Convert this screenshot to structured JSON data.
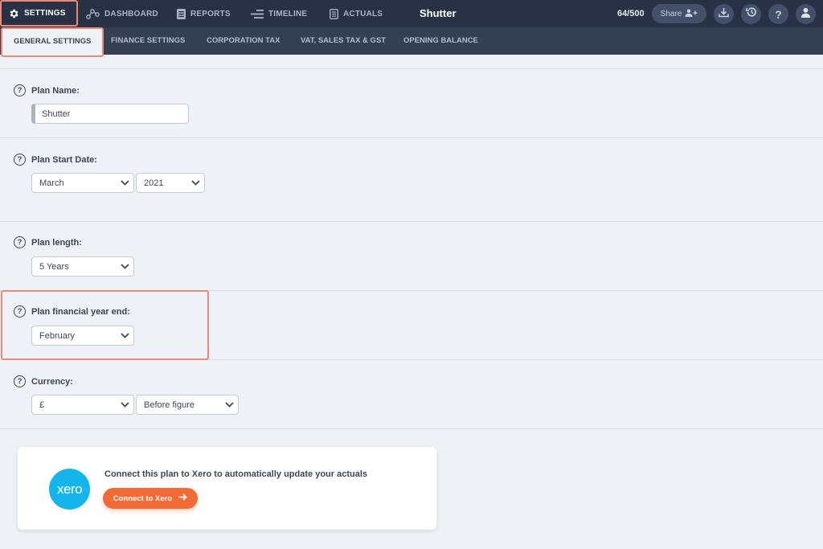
{
  "nav": {
    "items": [
      {
        "label": "SETTINGS",
        "icon": "gear-icon",
        "active": true
      },
      {
        "label": "DASHBOARD",
        "icon": "nodes-icon"
      },
      {
        "label": "REPORTS",
        "icon": "report-icon"
      },
      {
        "label": "TIMELINE",
        "icon": "timeline-icon"
      },
      {
        "label": "ACTUALS",
        "icon": "document-icon"
      }
    ],
    "plan_title": "Shutter",
    "usage": "64/500",
    "share_label": "Share",
    "buttons": [
      "download-icon",
      "history-icon",
      "help-icon",
      "account-icon"
    ],
    "help_glyph": "?"
  },
  "subtabs": [
    {
      "label": "GENERAL SETTINGS",
      "active": true
    },
    {
      "label": "FINANCE SETTINGS"
    },
    {
      "label": "CORPORATION TAX"
    },
    {
      "label": "VAT, SALES TAX & GST"
    },
    {
      "label": "OPENING BALANCE"
    }
  ],
  "help_glyph": "?",
  "fields": {
    "plan_name": {
      "label": "Plan Name:",
      "value": "Shutter"
    },
    "start_date": {
      "label": "Plan Start Date:",
      "month": "March",
      "year": "2021"
    },
    "plan_length": {
      "label": "Plan length:",
      "value": "5 Years"
    },
    "year_end": {
      "label": "Plan financial year end:",
      "value": "February"
    },
    "currency": {
      "label": "Currency:",
      "symbol": "£",
      "position": "Before figure"
    }
  },
  "xero": {
    "logo_text": "xero",
    "message": "Connect this plan to Xero to automatically update your actuals",
    "button_label": "Connect to Xero"
  },
  "colors": {
    "topbar": "#283244",
    "subbar": "#343f52",
    "highlight": "#e8897a",
    "xero_blue": "#13b5ea",
    "xero_button": "#f26a36",
    "background": "#eef1f5"
  }
}
